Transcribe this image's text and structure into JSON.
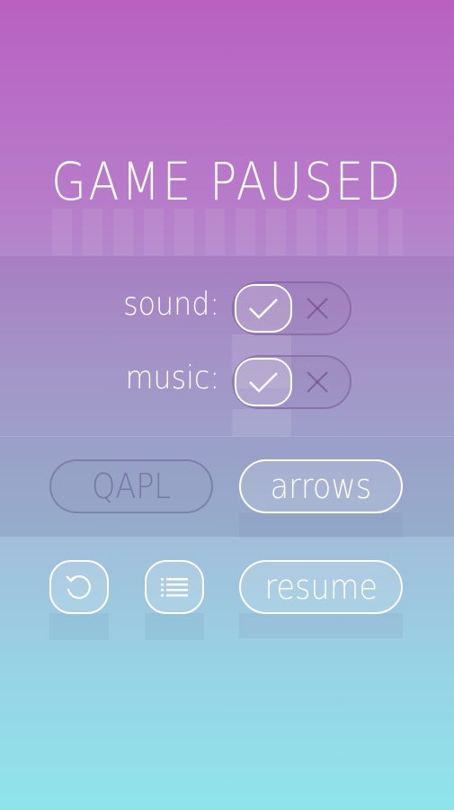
{
  "title": "GAME PAUSED",
  "settings": {
    "sound": {
      "label": "sound:",
      "enabled": true
    },
    "music": {
      "label": "music:",
      "enabled": true
    }
  },
  "controls": {
    "option_a": "QAPL",
    "option_b": "arrows",
    "selected": "arrows"
  },
  "actions": {
    "restart_icon": "restart-icon",
    "menu_icon": "list-icon",
    "resume_label": "resume"
  },
  "colors": {
    "gradient_top": "#b960c2",
    "gradient_bottom": "#8fe4ea"
  }
}
